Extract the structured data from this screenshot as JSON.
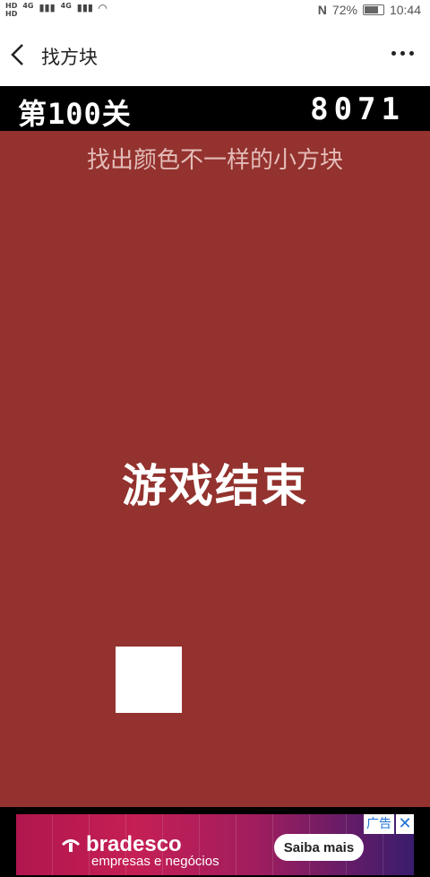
{
  "status_bar": {
    "network_left_top": "4G",
    "network_left_bottom": "4G",
    "battery": "72%",
    "time": "10:44"
  },
  "nav": {
    "title": "找方块",
    "back_icon": "chevron-left-icon",
    "more_icon": "more-dots-icon"
  },
  "game": {
    "level": "第100关",
    "score": "8071",
    "instruction": "找出颜色不一样的小方块",
    "game_over": "游戏结束",
    "background_color": "#93322e",
    "block_color": "#ffffff"
  },
  "ad": {
    "brand": "bradesco",
    "tagline": "empresas e negócios",
    "cta": "Saiba mais",
    "label": "广告",
    "close": "✕"
  }
}
